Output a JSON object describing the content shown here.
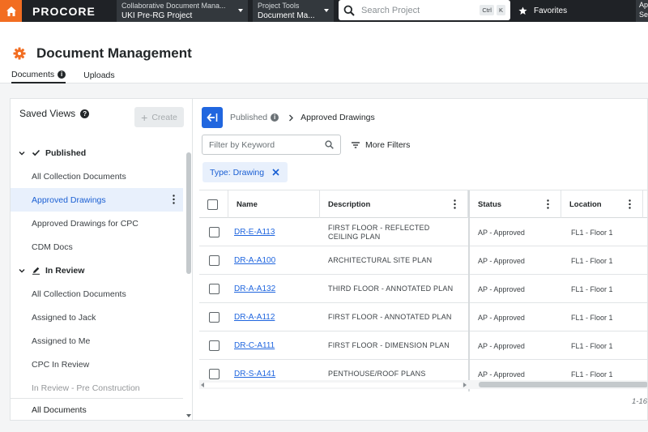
{
  "topbar": {
    "logo": "PROCORE",
    "company_picker": {
      "label": "Collaborative Document Mana...",
      "value": "UKI Pre-RG Project"
    },
    "tool_picker": {
      "label": "Project Tools",
      "value": "Document Ma..."
    },
    "search": {
      "placeholder": "Search Project",
      "kbd_1": "Ctrl",
      "kbd_2": "K"
    },
    "favorites": "Favorites",
    "right_stub_1": "Ap",
    "right_stub_2": "Se"
  },
  "header": {
    "title": "Document Management",
    "tabs": [
      {
        "label": "Documents",
        "active": true
      },
      {
        "label": "Uploads",
        "active": false
      }
    ],
    "accent_color": "#f26d21"
  },
  "sidebar": {
    "title": "Saved Views",
    "create_label": "Create",
    "groups": [
      {
        "label": "Published",
        "icon": "checkmark-icon",
        "items": [
          "All Collection Documents",
          "Approved Drawings",
          "Approved Drawings for CPC",
          "CDM Docs"
        ],
        "selected": "Approved Drawings"
      },
      {
        "label": "In Review",
        "icon": "pen-icon",
        "items": [
          "All Collection Documents",
          "Assigned to Jack",
          "Assigned to Me",
          "CPC In Review",
          "In Review - Pre Construction"
        ]
      }
    ],
    "footer_item": "All Documents"
  },
  "main": {
    "breadcrumb": {
      "parent": "Published",
      "current": "Approved Drawings"
    },
    "filter_placeholder": "Filter by Keyword",
    "more_filters": "More Filters",
    "chip": "Type: Drawing",
    "columns": [
      "Name",
      "Description",
      "Status",
      "Location"
    ],
    "rows": [
      {
        "name": "DR-E-A113",
        "description": "FIRST FLOOR - REFLECTED CEILING PLAN",
        "status": "AP - Approved",
        "location": "FL1 - Floor 1"
      },
      {
        "name": "DR-A-A100",
        "description": "ARCHITECTURAL SITE PLAN",
        "status": "AP - Approved",
        "location": "FL1 - Floor 1"
      },
      {
        "name": "DR-A-A132",
        "description": "THIRD FLOOR - ANNOTATED PLAN",
        "status": "AP - Approved",
        "location": "FL1 - Floor 1"
      },
      {
        "name": "DR-A-A112",
        "description": "FIRST FLOOR - ANNOTATED PLAN",
        "status": "AP - Approved",
        "location": "FL1 - Floor 1"
      },
      {
        "name": "DR-C-A111",
        "description": "FIRST FLOOR - DIMENSION PLAN",
        "status": "AP - Approved",
        "location": "FL1 - Floor 1"
      },
      {
        "name": "DR-S-A141",
        "description": "PENTHOUSE/ROOF PLANS",
        "status": "AP - Approved",
        "location": "FL1 - Floor 1"
      }
    ],
    "pager": "1-16",
    "link_color": "#2066df",
    "primary_color": "#2066df"
  }
}
